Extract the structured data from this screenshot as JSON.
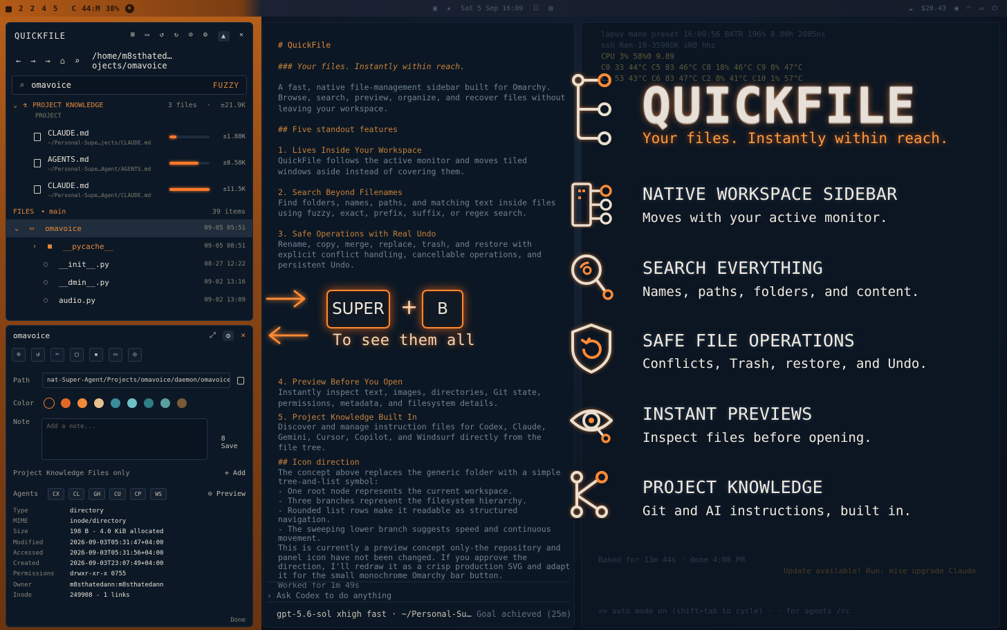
{
  "topbar": {
    "workspaces": [
      "2",
      "2",
      "4",
      "5"
    ],
    "left_extra": [
      "C",
      "44:M",
      "38%"
    ],
    "date": "Sat 5 Sep 16:09",
    "right": "$20.43"
  },
  "quickfile": {
    "title": "QUICKFILE",
    "path": "/home/m8sthated…ojects/omavoice",
    "search_value": "omavoice",
    "search_mode": "FUZZY",
    "project_knowledge": {
      "label": "PROJECT KNOWLEDGE",
      "count": "3 files",
      "size": "±21.9K",
      "sub": "PROJECT",
      "items": [
        {
          "name": "CLAUDE.md",
          "path": "~/Personal-Supe…jects/CLAUDE.md",
          "size": "±1.88K",
          "fill": 0.18
        },
        {
          "name": "AGENTS.md",
          "path": "~/Personal-Supe…Agent/AGENTS.md",
          "size": "±8.58K",
          "fill": 0.72
        },
        {
          "name": "CLAUDE.md",
          "path": "~/Personal-Supe…Agent/CLAUDE.md",
          "size": "±11.5K",
          "fill": 1.0
        }
      ]
    },
    "files": {
      "label": "FILES",
      "branch": "main",
      "count": "39 items",
      "rows": [
        {
          "name": "omavoice",
          "time": "09-05 05:51",
          "kind": "dir"
        },
        {
          "name": "__pycache__",
          "time": "09-05 08:51",
          "kind": "dir"
        },
        {
          "name": "__init__.py",
          "time": "08-27 12:22",
          "kind": "file"
        },
        {
          "name": "__dmin__.py",
          "time": "09-02 13:16",
          "kind": "file"
        },
        {
          "name": "audio.py",
          "time": "09-02 13:09",
          "kind": "file"
        }
      ]
    }
  },
  "inspector": {
    "title": "omavoice",
    "path_label": "Path",
    "path_value": "nat-Super-Agent/Projects/omavoice/daemon/omavoice",
    "color_label": "Color",
    "colors": [
      "#e26a25",
      "#f08a3a",
      "#e8c08e",
      "#3a8c98",
      "#6cc0c8",
      "#2f7f86",
      "#5a9ea0",
      "#7a5a34"
    ],
    "note_label": "Note",
    "note_placeholder": "Add a note...",
    "save_label": "8 Save",
    "pk_only": "Project Knowledge Files only",
    "add_label": "+ Add",
    "agents_label": "Agents",
    "agent_chips": [
      "CX",
      "CL",
      "GH",
      "CU",
      "CP",
      "WS"
    ],
    "preview_label": "Preview",
    "meta": [
      {
        "k": "Type",
        "v": "directory"
      },
      {
        "k": "MIME",
        "v": "inode/directory"
      },
      {
        "k": "Size",
        "v": "198 B - 4.0 KiB allocated"
      },
      {
        "k": "Modified",
        "v": "2026-09-03T05:31:47+04:00"
      },
      {
        "k": "Accessed",
        "v": "2026-09-03T05:31:56+04:00"
      },
      {
        "k": "Created",
        "v": "2026-09-03T23:07:49+04:00"
      },
      {
        "k": "Permissions",
        "v": "drwxr-xr-x  0755"
      },
      {
        "k": "Owner",
        "v": "m8sthatedann:m8sthatedann"
      },
      {
        "k": "Inode",
        "v": "249908 - 1 links"
      }
    ],
    "done_label": "Done"
  },
  "terminal": {
    "lines": [
      {
        "t": "# QuickFile",
        "c": "h"
      },
      {
        "t": "### Your files. Instantly within reach.",
        "c": "it"
      },
      {
        "t": "A fast, native file-management sidebar built for Omarchy.",
        "c": "n"
      },
      {
        "t": "Browse, search, preview, organize, and recover files without",
        "c": "n"
      },
      {
        "t": "leaving your workspace.",
        "c": "n"
      },
      {
        "t": "## Five standout features",
        "c": "o"
      },
      {
        "t": "1. Lives Inside Your Workspace",
        "c": "o"
      },
      {
        "t": "   QuickFile follows the active monitor and moves tiled",
        "c": "n"
      },
      {
        "t": "   windows aside instead of covering them.",
        "c": "n"
      },
      {
        "t": "2. Search Beyond Filenames",
        "c": "o"
      },
      {
        "t": "   Find folders, names, paths, and matching text inside files",
        "c": "n"
      },
      {
        "t": "   using fuzzy, exact, prefix, suffix, or regex search.",
        "c": "n"
      },
      {
        "t": "3. Safe Operations with Real Undo",
        "c": "o"
      },
      {
        "t": "   Rename, copy, merge, replace, trash, and restore with",
        "c": "n"
      },
      {
        "t": "   explicit conflict handling, cancellable operations, and",
        "c": "n"
      },
      {
        "t": "   persistent Undo.",
        "c": "n"
      },
      {
        "t": "4. Preview Before You Open",
        "c": "o"
      },
      {
        "t": "   Instantly inspect text, images, directories, Git state,",
        "c": "n"
      },
      {
        "t": "   permissions, metadata, and filesystem details.",
        "c": "n"
      },
      {
        "t": "5. Project Knowledge Built In",
        "c": "o"
      },
      {
        "t": "   Discover and manage instruction files for Codex, Claude,",
        "c": "n"
      },
      {
        "t": "   Gemini, Cursor, Copilot, and Windsurf directly from the",
        "c": "n"
      },
      {
        "t": "   file tree.",
        "c": "n"
      },
      {
        "t": "## Icon direction",
        "c": "o"
      },
      {
        "t": "The concept above replaces the generic folder with a simple",
        "c": "n"
      },
      {
        "t": "tree-and-list symbol:",
        "c": "n"
      },
      {
        "t": "- One root node represents the current workspace.",
        "c": "n"
      },
      {
        "t": "- Three branches represent the filesystem hierarchy.",
        "c": "n"
      },
      {
        "t": "- Rounded list rows make it readable as structured",
        "c": "n"
      },
      {
        "t": "  navigation.",
        "c": "n"
      },
      {
        "t": "- The sweeping lower branch suggests speed and continuous",
        "c": "n"
      },
      {
        "t": "  movement.",
        "c": "n"
      },
      {
        "t": "This is currently a preview concept only-the repository and",
        "c": "n"
      },
      {
        "t": "panel icon have not been changed. If you approve the",
        "c": "n"
      },
      {
        "t": "direction, I'll redraw it as a crisp production SVG and adapt",
        "c": "n"
      },
      {
        "t": "it for the small monochrome Omarchy bar button.",
        "c": "n"
      },
      {
        "t": "  Worked for 1m 49s",
        "c": "d"
      },
      {
        "t": "› Ask Codex to do anything",
        "c": "n"
      }
    ],
    "key1": "SUPER",
    "key2": "B",
    "plus": "+",
    "see_all": "To see them all",
    "footer": "gpt-5.6-sol xhigh fast · ~/Personal-Su…",
    "footer_dim": "Goal achieved (25m)"
  },
  "background": {
    "lines": [
      "lapuv     mano preset            16:09:56        BATR 196% 8.80h    2085ns",
      "                     ssh Ren-19-3598OK                             sR0 hhz",
      "CPU                                            3%                  58%0 9.89",
      "C0    33   44°C C5    83   46°C C8   18%  46°C C9    8%  47°C",
      "C1    53   43°C C6    83   47°C C2   8%   41°C C10  1%  57°C",
      "Update available! Run: mise upgrade Claude",
      ">> auto mode on (shift+tab to cycle) · · for agents               /rc",
      "Baked for 13m 44s · done 4:08 PM"
    ]
  },
  "hero": {
    "title": "QUICKFILE",
    "tagline": "Your files. Instantly within reach.",
    "features": [
      {
        "title": "NATIVE WORKSPACE SIDEBAR",
        "sub": "Moves with your active monitor."
      },
      {
        "title": "SEARCH EVERYTHING",
        "sub": "Names, paths, folders, and content."
      },
      {
        "title": "SAFE FILE OPERATIONS",
        "sub": "Conflicts, Trash, restore, and Undo."
      },
      {
        "title": "INSTANT PREVIEWS",
        "sub": "Inspect files before opening."
      },
      {
        "title": "PROJECT KNOWLEDGE",
        "sub": "Git and AI instructions, built in."
      }
    ]
  },
  "colors": {
    "accent": "#ff7a2a",
    "panel": "#0c1826",
    "text": "#e8e2d6"
  }
}
